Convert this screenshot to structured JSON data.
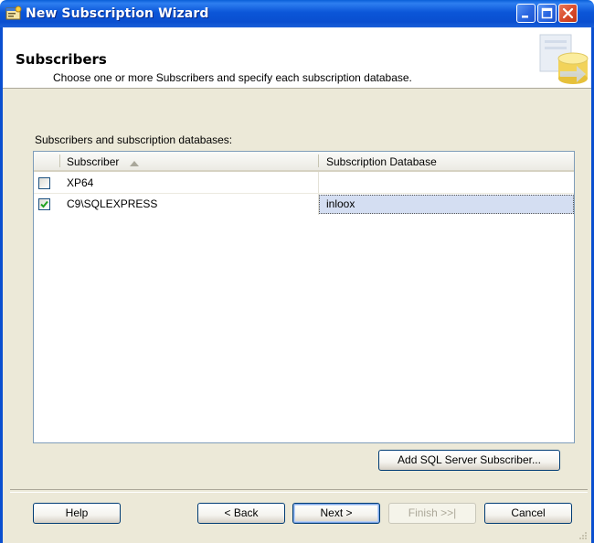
{
  "window": {
    "title": "New Subscription Wizard"
  },
  "header": {
    "title": "Subscribers",
    "subtitle": "Choose one or more Subscribers and specify each subscription database."
  },
  "list": {
    "label": "Subscribers and subscription databases:",
    "columns": {
      "subscriber": "Subscriber",
      "database": "Subscription Database"
    },
    "rows": [
      {
        "checked": false,
        "subscriber": "XP64",
        "database": ""
      },
      {
        "checked": true,
        "subscriber": "C9\\SQLEXPRESS",
        "database": "inloox"
      }
    ]
  },
  "buttons": {
    "add_subscriber": "Add SQL Server Subscriber...",
    "help": "Help",
    "back": "< Back",
    "next": "Next >",
    "finish": "Finish >>|",
    "cancel": "Cancel"
  },
  "colors": {
    "title_bar": "#0a4fd0",
    "dialog_bg": "#ece9d8",
    "selected_cell": "#d4def2",
    "check": "#21a121"
  },
  "icons": {
    "app": "wizard-window-icon",
    "sort": "sort-ascending-icon",
    "header_graphic": "database-graphic-icon"
  }
}
